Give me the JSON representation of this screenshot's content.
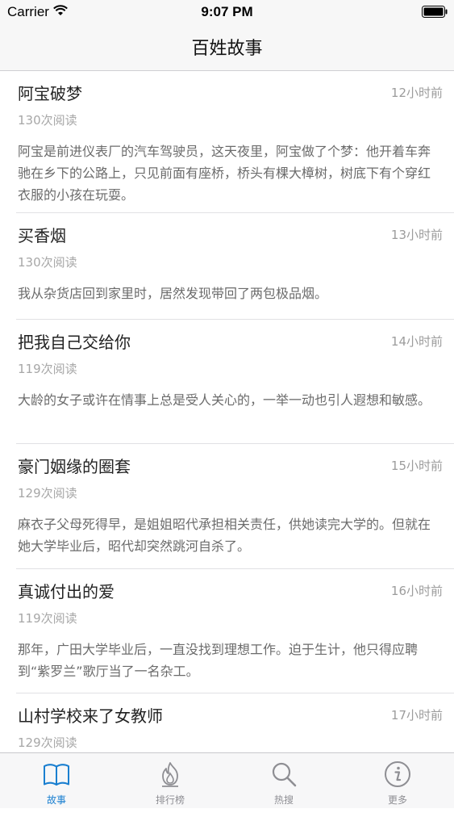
{
  "status_bar": {
    "carrier": "Carrier",
    "time": "9:07 PM"
  },
  "nav": {
    "title": "百姓故事"
  },
  "stories": [
    {
      "title": "阿宝破梦",
      "time": "12小时前",
      "reads": "130次阅读",
      "summary": "阿宝是前进仪表厂的汽车驾驶员，这天夜里，阿宝做了个梦：他开着车奔驰在乡下的公路上，只见前面有座桥，桥头有棵大樟树，树底下有个穿红衣服的小孩在玩耍。"
    },
    {
      "title": "买香烟",
      "time": "13小时前",
      "reads": "130次阅读",
      "summary": "我从杂货店回到家里时，居然发现带回了两包极品烟。"
    },
    {
      "title": "把我自己交给你",
      "time": "14小时前",
      "reads": "119次阅读",
      "summary": "大龄的女子或许在情事上总是受人关心的，一举一动也引人遐想和敏感。"
    },
    {
      "title": "豪门姻缘的圈套",
      "time": "15小时前",
      "reads": "129次阅读",
      "summary": "麻衣子父母死得早，是姐姐昭代承担相关责任，供她读完大学的。但就在她大学毕业后，昭代却突然跳河自杀了。"
    },
    {
      "title": "真诚付出的爱",
      "time": "16小时前",
      "reads": "119次阅读",
      "summary": "那年，广田大学毕业后，一直没找到理想工作。迫于生计，他只得应聘到“紫罗兰”歌厅当了一名杂工。"
    },
    {
      "title": "山村学校来了女教师",
      "time": "17小时前",
      "reads": "129次阅读",
      "summary": ""
    }
  ],
  "tabs": [
    {
      "label": "故事",
      "icon": "book-icon",
      "active": true
    },
    {
      "label": "排行榜",
      "icon": "fire-icon",
      "active": false
    },
    {
      "label": "热搜",
      "icon": "search-icon",
      "active": false
    },
    {
      "label": "更多",
      "icon": "info-icon",
      "active": false
    }
  ],
  "colors": {
    "accent": "#1a7fd0",
    "inactive": "#8e8e93"
  }
}
